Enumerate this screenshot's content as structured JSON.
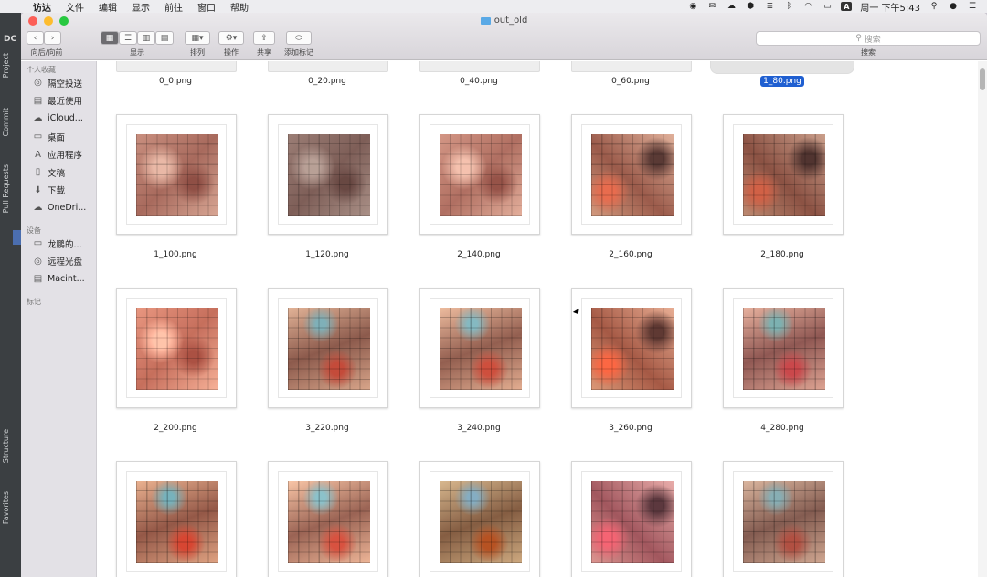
{
  "menubar": {
    "apple": "",
    "items": [
      "访达",
      "文件",
      "编辑",
      "显示",
      "前往",
      "窗口",
      "帮助"
    ],
    "clock": "周一 下午5:43",
    "input_method": "A"
  },
  "ide": {
    "project_short": "DC",
    "tabs_top": [
      "Project",
      "Commit",
      "Pull Requests"
    ],
    "tabs_bottom": [
      "Structure",
      "Favorites"
    ]
  },
  "window": {
    "title": "out_old",
    "toolbar": {
      "nav_label": "向后/向前",
      "view_label": "显示",
      "sort_label": "排列",
      "action_label": "操作",
      "share_label": "共享",
      "tag_label": "添加标记",
      "search_label": "搜索",
      "search_placeholder": "搜索"
    }
  },
  "sidebar": {
    "favorites_header": "个人收藏",
    "favorites": [
      {
        "label": "隔空投送",
        "icon": "airdrop-icon"
      },
      {
        "label": "最近使用",
        "icon": "recents-icon"
      },
      {
        "label": "iCloud...",
        "icon": "cloud-icon"
      },
      {
        "label": "桌面",
        "icon": "desktop-icon"
      },
      {
        "label": "应用程序",
        "icon": "applications-icon"
      },
      {
        "label": "文稿",
        "icon": "documents-icon"
      },
      {
        "label": "下载",
        "icon": "downloads-icon"
      },
      {
        "label": "OneDri...",
        "icon": "onedrive-icon"
      }
    ],
    "devices_header": "设备",
    "devices": [
      {
        "label": "龙鹏的...",
        "icon": "laptop-icon"
      },
      {
        "label": "远程光盘",
        "icon": "disc-icon"
      },
      {
        "label": "Macint...",
        "icon": "harddisk-icon"
      }
    ],
    "tags_header": "标记"
  },
  "files": {
    "row0": [
      "0_0.png",
      "0_20.png",
      "0_40.png",
      "0_60.png",
      "1_80.png"
    ],
    "row1": [
      "1_100.png",
      "1_120.png",
      "2_140.png",
      "2_160.png",
      "2_180.png"
    ],
    "row2": [
      "2_200.png",
      "3_220.png",
      "3_240.png",
      "3_260.png",
      "4_280.png"
    ],
    "selected": "1_80.png"
  },
  "colors": {
    "selection": "#1f5fd1",
    "close": "#fc5f57",
    "minimize": "#fdbc2e",
    "zoom": "#28c840"
  }
}
